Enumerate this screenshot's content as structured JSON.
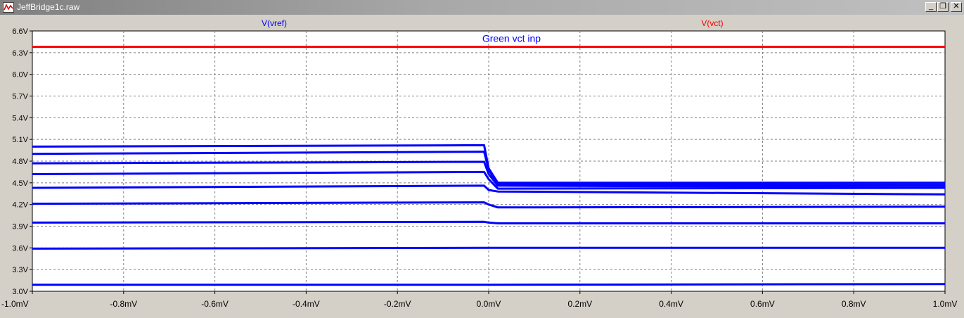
{
  "window": {
    "title": "JeffBridge1c.raw",
    "minimize_glyph": "_",
    "restore_glyph": "❐",
    "close_glyph": "✕"
  },
  "colors": {
    "vref": "#0000ff",
    "vct": "#ff0000",
    "annotation": "#0000ff",
    "plot_background": "#ffffff",
    "grid": "#808080"
  },
  "chart_data": {
    "type": "line",
    "legend": [
      {
        "name": "V(vref)",
        "color": "#0000ff"
      },
      {
        "name": "V(vct)",
        "color": "#ff0000"
      }
    ],
    "annotation": "Green vct inp",
    "x_ticks": [
      "-1.0mV",
      "-0.8mV",
      "-0.6mV",
      "-0.4mV",
      "-0.2mV",
      "0.0mV",
      "0.2mV",
      "0.4mV",
      "0.6mV",
      "0.8mV",
      "1.0mV"
    ],
    "y_ticks": [
      "3.0V",
      "3.3V",
      "3.6V",
      "3.9V",
      "4.2V",
      "4.5V",
      "4.8V",
      "5.1V",
      "5.4V",
      "5.7V",
      "6.0V",
      "6.3V",
      "6.6V"
    ],
    "xlim": [
      -1.0,
      1.0
    ],
    "ylim": [
      3.0,
      6.6
    ],
    "grid": true,
    "series": [
      {
        "name": "V(vct)",
        "color": "#ff0000",
        "x": [
          -1.0,
          1.0
        ],
        "y": [
          6.38,
          6.38
        ]
      },
      {
        "color": "#0000ff",
        "x": [
          -1.0,
          -0.01,
          0.0,
          0.02,
          1.0
        ],
        "y": [
          5.0,
          5.02,
          4.7,
          4.5,
          4.5
        ]
      },
      {
        "color": "#0000ff",
        "x": [
          -1.0,
          -0.01,
          0.0,
          0.02,
          1.0
        ],
        "y": [
          4.9,
          4.93,
          4.68,
          4.48,
          4.47
        ]
      },
      {
        "color": "#0000ff",
        "x": [
          -1.0,
          -0.01,
          0.0,
          0.02,
          1.0
        ],
        "y": [
          4.77,
          4.79,
          4.62,
          4.46,
          4.44
        ]
      },
      {
        "color": "#0000ff",
        "x": [
          -1.0,
          -0.01,
          0.0,
          0.02,
          1.0
        ],
        "y": [
          4.62,
          4.65,
          4.55,
          4.42,
          4.43
        ]
      },
      {
        "color": "#0000ff",
        "x": [
          -1.0,
          -0.01,
          0.0,
          0.02,
          1.0
        ],
        "y": [
          4.43,
          4.46,
          4.4,
          4.38,
          4.34
        ]
      },
      {
        "color": "#0000ff",
        "x": [
          -1.0,
          -0.01,
          0.0,
          0.02,
          1.0
        ],
        "y": [
          4.21,
          4.23,
          4.2,
          4.16,
          4.17
        ]
      },
      {
        "color": "#0000ff",
        "x": [
          -1.0,
          -0.01,
          0.0,
          0.02,
          1.0
        ],
        "y": [
          3.95,
          3.96,
          3.95,
          3.94,
          3.94
        ]
      },
      {
        "color": "#0000ff",
        "x": [
          -1.0,
          0.0,
          1.0
        ],
        "y": [
          3.59,
          3.6,
          3.6
        ]
      },
      {
        "color": "#0000ff",
        "x": [
          -1.0,
          0.0,
          1.0
        ],
        "y": [
          3.09,
          3.09,
          3.1
        ]
      }
    ]
  }
}
